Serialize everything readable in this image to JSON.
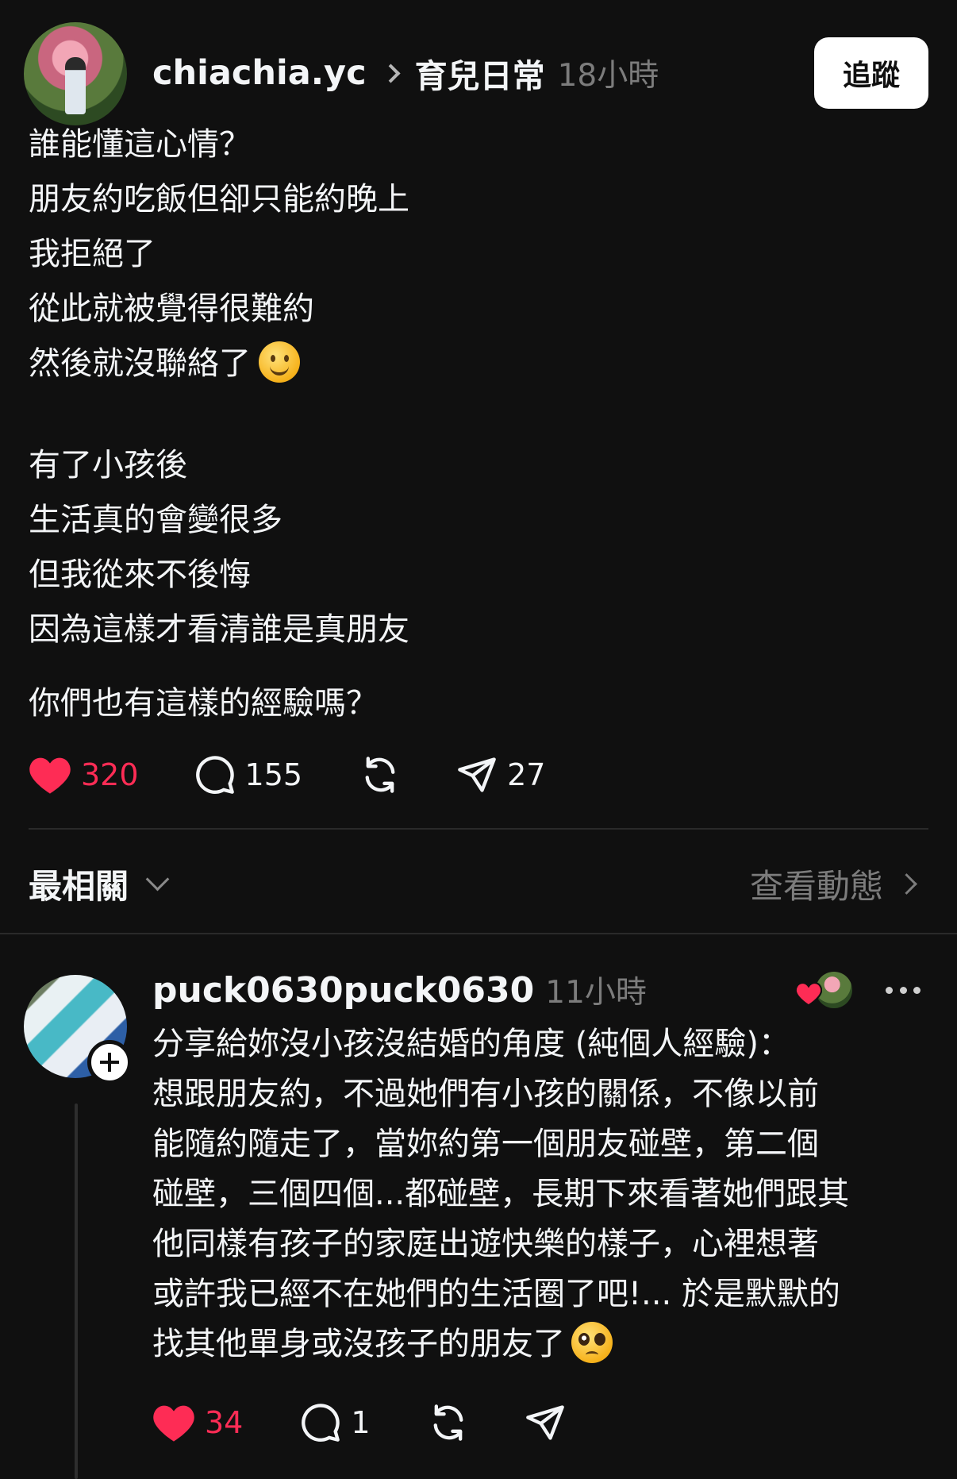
{
  "post": {
    "author": "chiachia.yc",
    "topic": "育兒日常",
    "time": "18小時",
    "follow_label": "追蹤",
    "paragraphs": [
      [
        "誰能懂這心情？",
        "朋友約吃飯但卻只能約晚上",
        "我拒絕了",
        "從此就被覺得很難約",
        "然後就沒聯絡了"
      ],
      [
        "有了小孩後",
        "生活真的會變很多",
        "但我從來不後悔",
        "因為這樣才看清誰是真朋友"
      ],
      [
        "你們也有這樣的經驗嗎？"
      ]
    ],
    "likes": "320",
    "comments": "155",
    "shares": "27",
    "liked": true
  },
  "comments_section": {
    "sort_label": "最相關",
    "activity_label": "查看動態"
  },
  "reply": {
    "author": "puck0630puck0630",
    "time": "11小時",
    "lines": [
      "分享給妳沒小孩沒結婚的角度 (純個人經驗)：",
      "想跟朋友約，不過她們有小孩的關係，不像以前",
      "能隨約隨走了，當妳約第一個朋友碰壁，第二個",
      "碰壁，三個四個...都碰壁，長期下來看著她們跟其",
      "他同樣有孩子的家庭出遊快樂的樣子，心裡想著",
      "或許我已經不在她們的生活圈了吧!... 於是默默的",
      "找其他單身或沒孩子的朋友了"
    ],
    "likes": "34",
    "comments": "1",
    "liked": true
  },
  "colors": {
    "background": "#101010",
    "text": "#f3f5f7",
    "muted": "#7c7c7c",
    "like": "#fe2c55"
  },
  "icons": {
    "post_emoji": "slightly-smiling-face",
    "reply_emoji": "pleading-face"
  }
}
